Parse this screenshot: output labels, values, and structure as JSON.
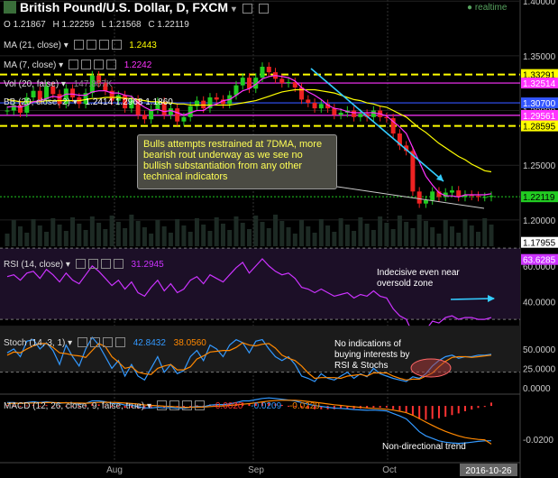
{
  "header": {
    "title": "British Pound/U.S. Dollar, D, FXCM",
    "realtime": "realtime",
    "ohlc": {
      "o_label": "O",
      "o": "1.21867",
      "h_label": "H",
      "h": "1.22259",
      "l_label": "L",
      "l": "1.21568",
      "c_label": "C",
      "c": "1.22119"
    }
  },
  "indicators": {
    "ma21": {
      "label": "MA (21, close)",
      "value": "1.2443",
      "color": "#ffff00"
    },
    "ma7": {
      "label": "MA (7, close)",
      "value": "1.2242",
      "color": "#ff33ff"
    },
    "vol": {
      "label": "Vol (20, false)",
      "value": "147.887K"
    },
    "bb": {
      "label": "BB (20, close, 2)",
      "values": "1.2414  1.2968  1.1860"
    },
    "rsi": {
      "label": "RSI (14, close)",
      "value": "31.2945",
      "color": "#cc33ff"
    },
    "stoch": {
      "label": "Stoch (14, 3, 1)",
      "k": "42.8432",
      "d": "38.0560",
      "k_color": "#3399ff",
      "d_color": "#ff8800"
    },
    "macd": {
      "label": "MACD (12, 26, close, 9, false, true)",
      "v1": "-0.0020",
      "v2": "-0.0209",
      "v3": "-0.0229",
      "colors": [
        "#ff3333",
        "#3399ff",
        "#ff8800"
      ]
    }
  },
  "annotations": {
    "callout": "Bulls attempts restrained at 7DMA, more bearish rout underway as we see no bullish substantiation from any other technical indicators",
    "rsi_note": "Indecisive even near oversold zone",
    "stoch_note": "No indications of buying interests by RSI & Stochs",
    "macd_note": "Non-directional trend"
  },
  "chart_data": {
    "type": "line",
    "price_axis": {
      "ticks": [
        "1.40000",
        "1.35000",
        "1.30000",
        "1.25000",
        "1.20000"
      ],
      "ylim": [
        1.176,
        1.401
      ],
      "levels": [
        {
          "label": "1.33291",
          "color": "#ffff00"
        },
        {
          "label": "1.32514",
          "color": "#ff33ff"
        },
        {
          "label": "1.30700",
          "color": "#3355ff"
        },
        {
          "label": "1.29561",
          "color": "#ff33ff"
        },
        {
          "label": "1.28595",
          "color": "#ffff00"
        },
        {
          "label": "1.22119",
          "color": "#22cc22"
        },
        {
          "label": "1.17955",
          "color": "#ffffff"
        }
      ]
    },
    "x_axis": {
      "ticks": [
        "Aug",
        "Sep",
        "Oct"
      ],
      "current_date": "2016-10-26"
    },
    "series": [
      {
        "name": "Close",
        "values": [
          1.3,
          1.305,
          1.298,
          1.312,
          1.318,
          1.31,
          1.322,
          1.315,
          1.306,
          1.32,
          1.312,
          1.306,
          1.316,
          1.332,
          1.325,
          1.318,
          1.309,
          1.314,
          1.302,
          1.31,
          1.296,
          1.292,
          1.301,
          1.308,
          1.296,
          1.302,
          1.29,
          1.294,
          1.304,
          1.309,
          1.302,
          1.312,
          1.31,
          1.306,
          1.314,
          1.323,
          1.33,
          1.32,
          1.33,
          1.34,
          1.335,
          1.329,
          1.325,
          1.326,
          1.321,
          1.31,
          1.307,
          1.302,
          1.306,
          1.302,
          1.296,
          1.298,
          1.3,
          1.294,
          1.297,
          1.294,
          1.3,
          1.294,
          1.293,
          1.279,
          1.268,
          1.263,
          1.226,
          1.215,
          1.218,
          1.226,
          1.221,
          1.225,
          1.227,
          1.221,
          1.223,
          1.222,
          1.221,
          1.221,
          1.222
        ]
      },
      {
        "name": "MA (21, close)",
        "values": [
          1.31,
          1.309,
          1.308,
          1.308,
          1.308,
          1.308,
          1.309,
          1.309,
          1.309,
          1.309,
          1.309,
          1.309,
          1.31,
          1.311,
          1.311,
          1.312,
          1.312,
          1.312,
          1.311,
          1.311,
          1.31,
          1.309,
          1.308,
          1.308,
          1.307,
          1.307,
          1.306,
          1.306,
          1.305,
          1.305,
          1.305,
          1.305,
          1.305,
          1.305,
          1.305,
          1.306,
          1.307,
          1.308,
          1.309,
          1.311,
          1.313,
          1.315,
          1.317,
          1.318,
          1.319,
          1.319,
          1.319,
          1.319,
          1.318,
          1.317,
          1.316,
          1.314,
          1.312,
          1.31,
          1.309,
          1.307,
          1.306,
          1.304,
          1.303,
          1.3,
          1.297,
          1.294,
          1.289,
          1.284,
          1.28,
          1.275,
          1.27,
          1.266,
          1.262,
          1.258,
          1.255,
          1.251,
          1.248,
          1.245,
          1.244
        ]
      },
      {
        "name": "MA (7, close)",
        "values": [
          1.303,
          1.304,
          1.303,
          1.305,
          1.308,
          1.309,
          1.311,
          1.313,
          1.312,
          1.315,
          1.315,
          1.314,
          1.314,
          1.317,
          1.318,
          1.318,
          1.316,
          1.316,
          1.314,
          1.313,
          1.307,
          1.303,
          1.3,
          1.301,
          1.299,
          1.3,
          1.298,
          1.296,
          1.298,
          1.3,
          1.3,
          1.304,
          1.306,
          1.309,
          1.31,
          1.314,
          1.318,
          1.32,
          1.324,
          1.329,
          1.331,
          1.332,
          1.331,
          1.33,
          1.327,
          1.321,
          1.317,
          1.314,
          1.31,
          1.305,
          1.302,
          1.301,
          1.299,
          1.298,
          1.298,
          1.298,
          1.298,
          1.297,
          1.295,
          1.29,
          1.285,
          1.279,
          1.266,
          1.253,
          1.24,
          1.232,
          1.225,
          1.222,
          1.222,
          1.221,
          1.223,
          1.223,
          1.223,
          1.223,
          1.224
        ]
      }
    ],
    "rsi": {
      "ticks": [
        "60.0000",
        "40.0000"
      ],
      "ylim": [
        25,
        66
      ],
      "value_label": "63.6285",
      "values": [
        54,
        55,
        52,
        56,
        57,
        53,
        58,
        55,
        51,
        56,
        52,
        50,
        55,
        60,
        57,
        53,
        49,
        52,
        47,
        51,
        45,
        43,
        48,
        52,
        46,
        50,
        45,
        47,
        52,
        54,
        50,
        55,
        53,
        51,
        55,
        59,
        62,
        56,
        60,
        64,
        60,
        57,
        55,
        56,
        53,
        48,
        47,
        45,
        47,
        45,
        43,
        44,
        45,
        42,
        44,
        43,
        46,
        43,
        42,
        36,
        32,
        30,
        22,
        20,
        24,
        29,
        28,
        31,
        32,
        30,
        31,
        31,
        30,
        30,
        31
      ]
    },
    "stoch": {
      "ticks": [
        "50.0000",
        "25.0000",
        "0.0000"
      ],
      "ylim": [
        -6,
        72
      ],
      "k": [
        45,
        50,
        40,
        60,
        62,
        50,
        58,
        48,
        30,
        55,
        40,
        28,
        50,
        65,
        55,
        40,
        25,
        35,
        15,
        30,
        15,
        10,
        25,
        40,
        20,
        30,
        18,
        22,
        40,
        48,
        35,
        55,
        50,
        40,
        55,
        62,
        58,
        45,
        60,
        62,
        50,
        40,
        35,
        40,
        30,
        15,
        12,
        8,
        18,
        12,
        10,
        15,
        20,
        12,
        18,
        14,
        25,
        18,
        15,
        12,
        10,
        8,
        14,
        12,
        18,
        28,
        35,
        40,
        42,
        38,
        40,
        40,
        42,
        42,
        43
      ],
      "d": [
        42,
        46,
        45,
        50,
        54,
        57,
        57,
        52,
        45,
        44,
        42,
        41,
        39,
        48,
        57,
        53,
        40,
        33,
        25,
        27,
        20,
        18,
        17,
        25,
        28,
        30,
        23,
        23,
        27,
        37,
        41,
        46,
        47,
        48,
        48,
        52,
        58,
        55,
        54,
        56,
        57,
        51,
        42,
        38,
        35,
        28,
        19,
        12,
        13,
        13,
        13,
        12,
        15,
        16,
        17,
        15,
        19,
        19,
        19,
        15,
        12,
        10,
        11,
        11,
        15,
        19,
        27,
        34,
        39,
        40,
        40,
        39,
        40,
        41,
        42
      ]
    },
    "macd": {
      "ticks": [
        "-0.0200"
      ],
      "ylim": [
        -0.033,
        0.006
      ],
      "macd": [
        0.002,
        0.002,
        0.0015,
        0.002,
        0.0025,
        0.002,
        0.0025,
        0.002,
        0.0015,
        0.002,
        0.0015,
        0.001,
        0.0015,
        0.003,
        0.003,
        0.0025,
        0.0015,
        0.0015,
        0.0005,
        0.0005,
        -0.0005,
        -0.0012,
        -0.0012,
        -0.0008,
        -0.0012,
        -0.001,
        -0.0015,
        -0.0015,
        -0.0008,
        -0.0003,
        -0.0005,
        0.0005,
        0.0008,
        0.0008,
        0.0012,
        0.002,
        0.003,
        0.003,
        0.0038,
        0.0045,
        0.0048,
        0.0045,
        0.004,
        0.0035,
        0.003,
        0.002,
        0.001,
        0.0002,
        -0.0003,
        -0.0008,
        -0.0013,
        -0.0015,
        -0.0018,
        -0.0022,
        -0.0024,
        -0.0026,
        -0.0025,
        -0.0027,
        -0.003,
        -0.0045,
        -0.006,
        -0.0078,
        -0.0115,
        -0.0155,
        -0.018,
        -0.0195,
        -0.021,
        -0.0218,
        -0.0222,
        -0.0225,
        -0.0222,
        -0.0218,
        -0.0213,
        -0.021,
        -0.0209
      ],
      "signal": [
        0.0015,
        0.0016,
        0.0016,
        0.0017,
        0.0018,
        0.0019,
        0.002,
        0.002,
        0.0019,
        0.0019,
        0.0018,
        0.0017,
        0.0016,
        0.0019,
        0.0021,
        0.0022,
        0.0021,
        0.002,
        0.0017,
        0.0015,
        0.0011,
        0.0006,
        0.0003,
        0.0001,
        -0.0002,
        -0.0003,
        -0.0006,
        -0.0008,
        -0.0008,
        -0.0007,
        -0.0007,
        -0.0004,
        -0.0002,
        0.0,
        0.0003,
        0.0006,
        0.001,
        0.0014,
        0.0019,
        0.0024,
        0.0029,
        0.0032,
        0.0034,
        0.0034,
        0.0034,
        0.0031,
        0.0027,
        0.0022,
        0.0017,
        0.0012,
        0.0007,
        0.0003,
        -0.0001,
        -0.0005,
        -0.0009,
        -0.0012,
        -0.0015,
        -0.0017,
        -0.002,
        -0.0025,
        -0.0032,
        -0.0041,
        -0.0056,
        -0.0076,
        -0.0097,
        -0.0117,
        -0.0136,
        -0.0153,
        -0.0167,
        -0.018,
        -0.019,
        -0.0196,
        -0.0201,
        -0.0204,
        -0.0229
      ]
    }
  }
}
